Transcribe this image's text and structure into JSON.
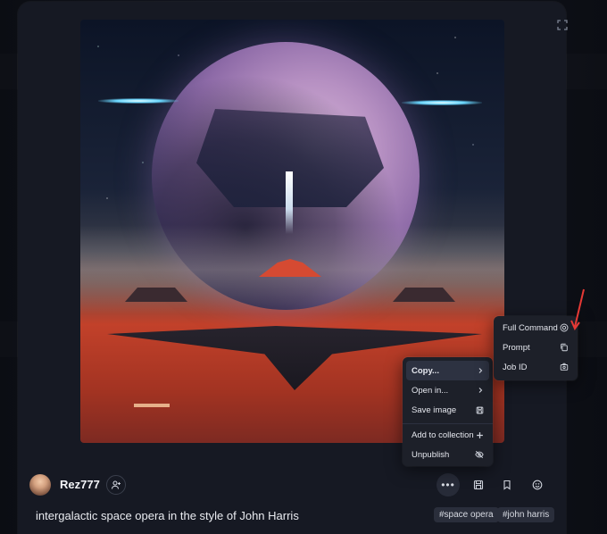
{
  "user": {
    "name": "Rez777"
  },
  "prompt": "intergalactic space opera in the style of John Harris",
  "tags": [
    "#space opera",
    "#john harris"
  ],
  "actions_menu": {
    "items": [
      {
        "label": "Copy...",
        "icon": "chevron-right-icon"
      },
      {
        "label": "Open in...",
        "icon": "chevron-right-icon"
      },
      {
        "label": "Save image",
        "icon": "save-icon"
      },
      {
        "label": "Add to collection",
        "icon": "plus-icon"
      },
      {
        "label": "Unpublish",
        "icon": "eye-off-icon"
      }
    ]
  },
  "copy_submenu": {
    "items": [
      {
        "label": "Full Command",
        "icon": "command-icon"
      },
      {
        "label": "Prompt",
        "icon": "copy-icon"
      },
      {
        "label": "Job ID",
        "icon": "id-card-icon"
      }
    ]
  },
  "colors": {
    "accent_arrow": "#e53935",
    "card_bg": "#161923",
    "menu_bg": "#1d2029"
  }
}
